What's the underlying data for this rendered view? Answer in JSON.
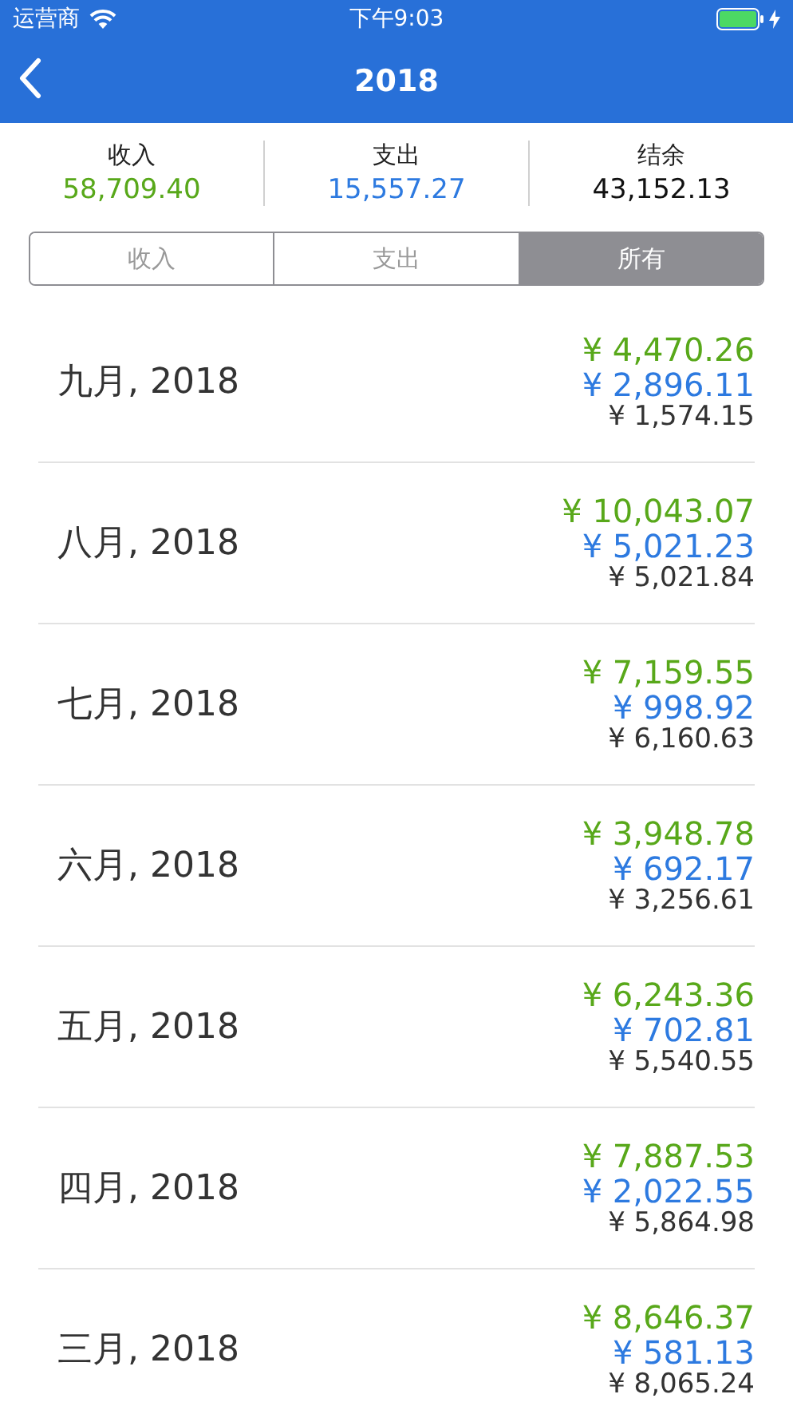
{
  "status_bar": {
    "carrier": "运营商",
    "time": "下午9:03"
  },
  "nav": {
    "title": "2018"
  },
  "summary": [
    {
      "kind": "income",
      "label": "收入",
      "value": "58,709.40"
    },
    {
      "kind": "expense",
      "label": "支出",
      "value": "15,557.27"
    },
    {
      "kind": "balance",
      "label": "结余",
      "value": "43,152.13"
    }
  ],
  "segments": [
    {
      "label": "收入",
      "selected": false
    },
    {
      "label": "支出",
      "selected": false
    },
    {
      "label": "所有",
      "selected": true
    }
  ],
  "months": [
    {
      "month": "九月, 2018",
      "income": "¥ 4,470.26",
      "expense": "¥ 2,896.11",
      "balance": "¥ 1,574.15"
    },
    {
      "month": "八月, 2018",
      "income": "¥ 10,043.07",
      "expense": "¥ 5,021.23",
      "balance": "¥ 5,021.84"
    },
    {
      "month": "七月, 2018",
      "income": "¥ 7,159.55",
      "expense": "¥ 998.92",
      "balance": "¥ 6,160.63"
    },
    {
      "month": "六月, 2018",
      "income": "¥ 3,948.78",
      "expense": "¥ 692.17",
      "balance": "¥ 3,256.61"
    },
    {
      "month": "五月, 2018",
      "income": "¥ 6,243.36",
      "expense": "¥ 702.81",
      "balance": "¥ 5,540.55"
    },
    {
      "month": "四月, 2018",
      "income": "¥ 7,887.53",
      "expense": "¥ 2,022.55",
      "balance": "¥ 5,864.98"
    },
    {
      "month": "三月, 2018",
      "income": "¥ 8,646.37",
      "expense": "¥ 581.13",
      "balance": "¥ 8,065.24"
    }
  ]
}
